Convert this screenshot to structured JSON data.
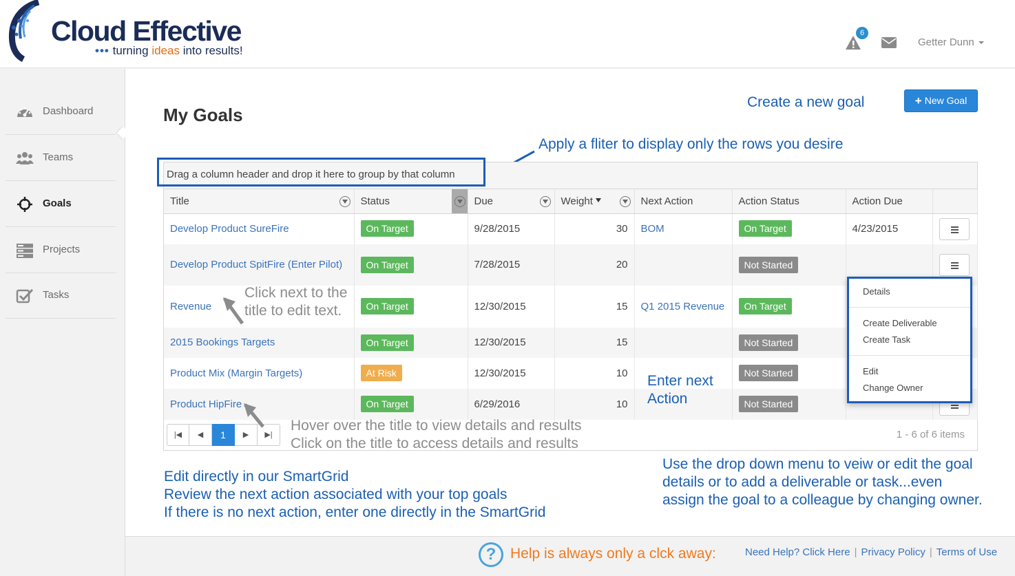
{
  "brand": {
    "name": "Cloud Effective",
    "tagline_dots": "•••",
    "tagline_pre": "turning",
    "tagline_highlight": "ideas",
    "tagline_post": "into results!"
  },
  "header": {
    "alert_count": "6",
    "user_name": "Getter Dunn"
  },
  "sidebar": {
    "items": [
      {
        "label": "Dashboard",
        "icon": "dashboard-gauge-icon"
      },
      {
        "label": "Teams",
        "icon": "users-icon"
      },
      {
        "label": "Goals",
        "icon": "crosshair-icon"
      },
      {
        "label": "Projects",
        "icon": "server-stack-icon"
      },
      {
        "label": "Tasks",
        "icon": "checkbox-icon"
      }
    ]
  },
  "page": {
    "title": "My Goals",
    "new_goal_label": "New Goal"
  },
  "grid": {
    "group_hint": "Drag a column header and drop it here to group by that column",
    "columns": [
      "Title",
      "Status",
      "Due",
      "Weight",
      "Next Action",
      "Action Status",
      "Action Due"
    ],
    "rows": [
      {
        "title": "Develop Product SureFire",
        "status": "On Target",
        "due": "9/28/2015",
        "weight": "30",
        "next_action": "BOM",
        "action_status": "On Target",
        "action_due": "4/23/2015"
      },
      {
        "title": "Develop Product SpitFire (Enter Pilot)",
        "status": "On Target",
        "due": "7/28/2015",
        "weight": "20",
        "next_action": "",
        "action_status": "Not Started",
        "action_due": ""
      },
      {
        "title": "Revenue",
        "status": "On Target",
        "due": "12/30/2015",
        "weight": "15",
        "next_action": "Q1 2015 Revenue",
        "action_status": "On Target",
        "action_due": ""
      },
      {
        "title": "2015 Bookings Targets",
        "status": "On Target",
        "due": "12/30/2015",
        "weight": "15",
        "next_action": "",
        "action_status": "Not Started",
        "action_due": ""
      },
      {
        "title": "Product Mix (Margin Targets)",
        "status": "At Risk",
        "due": "12/30/2015",
        "weight": "10",
        "next_action": "",
        "action_status": "Not Started",
        "action_due": ""
      },
      {
        "title": "Product HipFire",
        "status": "On Target",
        "due": "6/29/2016",
        "weight": "10",
        "next_action": "",
        "action_status": "Not Started",
        "action_due": ""
      }
    ],
    "pager": {
      "first": "|◀",
      "prev": "◀",
      "current": "1",
      "next": "▶",
      "last": "▶|",
      "info": "1 - 6 of 6 items"
    }
  },
  "row_menu": {
    "details": "Details",
    "create_deliverable": "Create Deliverable",
    "create_task": "Create Task",
    "edit": "Edit",
    "change_owner": "Change Owner"
  },
  "annotations": {
    "create_goal": "Create a new goal",
    "apply_filter": "Apply a fliter to display only the rows you desire",
    "click_next_1": "Click next to the",
    "click_next_2": "title to edit text.",
    "enter_next_1": "Enter next",
    "enter_next_2": "Action",
    "hover_1": "Hover over the title to view details and results",
    "hover_2": "Click on the title to access details and results",
    "smartgrid_1": "Edit directly in our SmartGrid",
    "smartgrid_2": "Review the next action associated with your top goals",
    "smartgrid_3": "If there is no next action, enter one directly in the SmartGrid",
    "dropdown_1": "Use the drop down menu to veiw or edit the goal",
    "dropdown_2": "details or to add a deliverable or task...even",
    "dropdown_3": "assign the goal to a colleague by changing owner.",
    "help": "Help is always only a clck away:"
  },
  "footer": {
    "need_help": "Need Help? Click Here",
    "privacy": "Privacy Policy",
    "terms": "Terms of Use",
    "separator": "|"
  },
  "colors": {
    "brand_navy": "#1a2c57",
    "accent_blue": "#2a86d8",
    "annotation_blue": "#1a5fb4",
    "status_green": "#5cb85c",
    "status_orange": "#f0ad4e",
    "status_grey": "#8a8a8a"
  }
}
